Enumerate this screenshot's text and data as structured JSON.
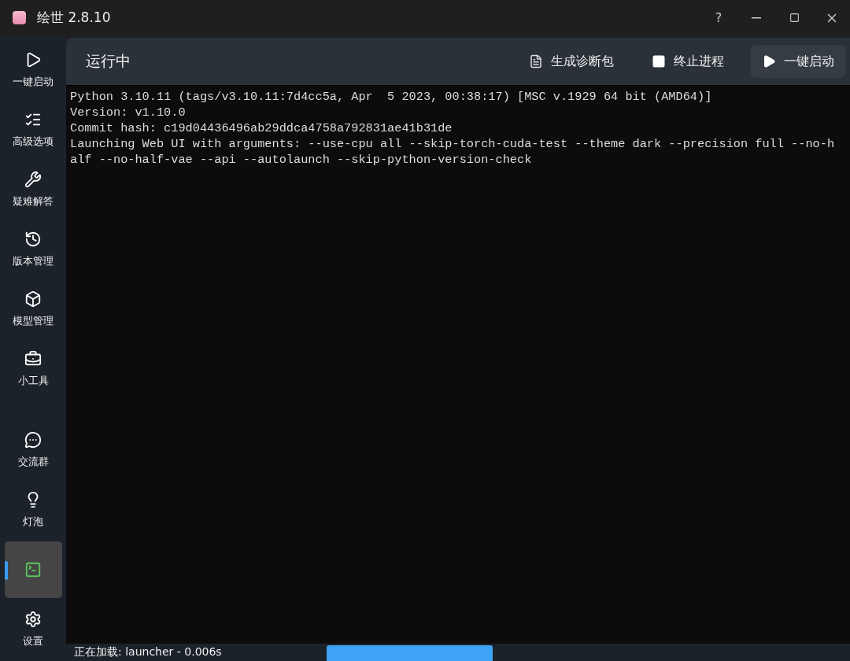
{
  "window": {
    "title": "绘世 2.8.10",
    "help": "?"
  },
  "sidebar": {
    "items": [
      {
        "label": "一键启动",
        "selected": false
      },
      {
        "label": "高级选项",
        "selected": false
      },
      {
        "label": "疑难解答",
        "selected": false
      },
      {
        "label": "版本管理",
        "selected": false
      },
      {
        "label": "模型管理",
        "selected": false
      },
      {
        "label": "小工具",
        "selected": false
      }
    ],
    "bottom_items": [
      {
        "label": "交流群",
        "selected": false
      },
      {
        "label": "灯泡",
        "selected": false
      },
      {
        "selected": true
      },
      {
        "label": "设置",
        "selected": false
      }
    ]
  },
  "header": {
    "title": "运行中",
    "actions": [
      {
        "label": "生成诊断包",
        "kind": "doc"
      },
      {
        "label": "终止进程",
        "kind": "stop"
      },
      {
        "label": "一键启动",
        "kind": "play"
      }
    ]
  },
  "console": {
    "lines": [
      "Python 3.10.11 (tags/v3.10.11:7d4cc5a, Apr  5 2023, 00:38:17) [MSC v.1929 64 bit (AMD64)]",
      "Version: v1.10.0",
      "Commit hash: c19d04436496ab29ddca4758a792831ae41b31de",
      "Launching Web UI with arguments: --use-cpu all --skip-torch-cuda-test --theme dark --precision full --no-half --no-half-vae --api --autolaunch --skip-python-version-check"
    ]
  },
  "status_bar": {
    "text": "正在加载: launcher - 0.006s"
  }
}
